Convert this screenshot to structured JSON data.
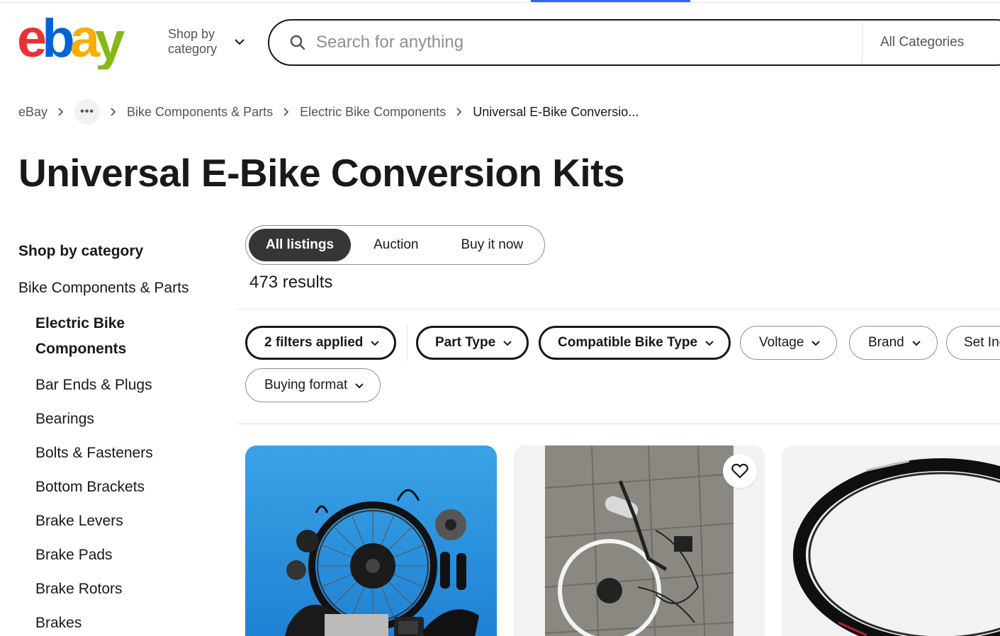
{
  "header": {
    "logo_letters": [
      "e",
      "b",
      "a",
      "y"
    ],
    "logo_colors": [
      "#e53238",
      "#0064d2",
      "#f5af02",
      "#86b817"
    ],
    "shop_by_category": "Shop by category",
    "search_placeholder": "Search for anything",
    "search_category": "All Categories"
  },
  "breadcrumb": {
    "items": [
      "eBay",
      "Bike Components & Parts",
      "Electric Bike Components",
      "Universal E-Bike Conversio..."
    ],
    "more_label": "•••"
  },
  "page": {
    "title": "Universal E-Bike Conversion Kits"
  },
  "sidebar": {
    "heading": "Shop by category",
    "parent": "Bike Components & Parts",
    "current": "Electric Bike Components",
    "items": [
      "Bar Ends & Plugs",
      "Bearings",
      "Bolts & Fasteners",
      "Bottom Brackets",
      "Brake Levers",
      "Brake Pads",
      "Brake Rotors",
      "Brakes"
    ]
  },
  "listing_tabs": {
    "tabs": [
      "All listings",
      "Auction",
      "Buy it now"
    ],
    "active_index": 0
  },
  "results": {
    "count_label": "473 results"
  },
  "filters": {
    "chips": [
      "2 filters applied",
      "Part Type",
      "Compatible Bike Type",
      "Voltage",
      "Brand",
      "Set Inc",
      "Buying format"
    ]
  },
  "colors": {
    "accent": "#3665f3",
    "text": "#191919",
    "muted": "#555555"
  },
  "icons": {
    "search": "search-icon",
    "chevron": "chevron-down-icon",
    "watch": "heart-icon"
  }
}
